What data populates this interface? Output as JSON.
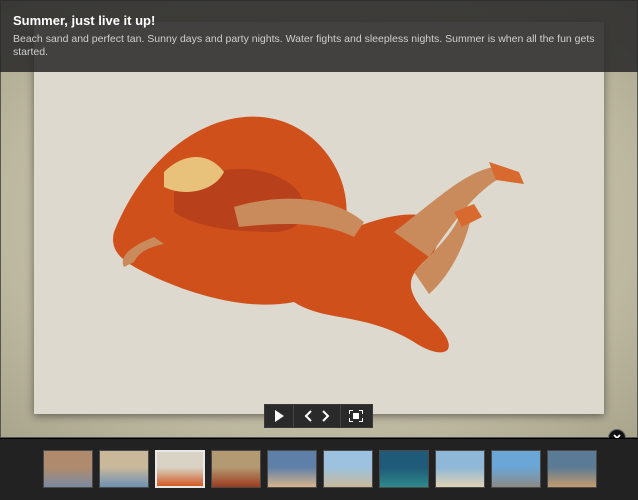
{
  "caption": {
    "title": "Summer, just live it up!",
    "text": "Beach sand and perfect tan. Sunny days and party nights. Water fights and sleepless nights. Summer is when all the fun gets started."
  },
  "controls": [
    {
      "name": "play-icon"
    },
    {
      "name": "chevron-left-icon"
    },
    {
      "name": "chevron-right-icon"
    },
    {
      "name": "fullscreen-icon"
    }
  ],
  "thumbnails": {
    "count": 10,
    "active_index": 2,
    "colors": [
      [
        "#b08a6c",
        "#7a8aa0"
      ],
      [
        "#c9b99a",
        "#6e8fb3"
      ],
      [
        "#d9d3c6",
        "#d05a24"
      ],
      [
        "#b39a72",
        "#9c3b1f"
      ],
      [
        "#5e7fa8",
        "#d6b48a"
      ],
      [
        "#9cc2df",
        "#c8b89a"
      ],
      [
        "#1f5a78",
        "#2e8a8c"
      ],
      [
        "#8fb7d8",
        "#e0d3b5"
      ],
      [
        "#6aa6d6",
        "#8c8a84"
      ],
      [
        "#5b7a95",
        "#c49a6c"
      ]
    ]
  },
  "close_icon": "close-icon"
}
